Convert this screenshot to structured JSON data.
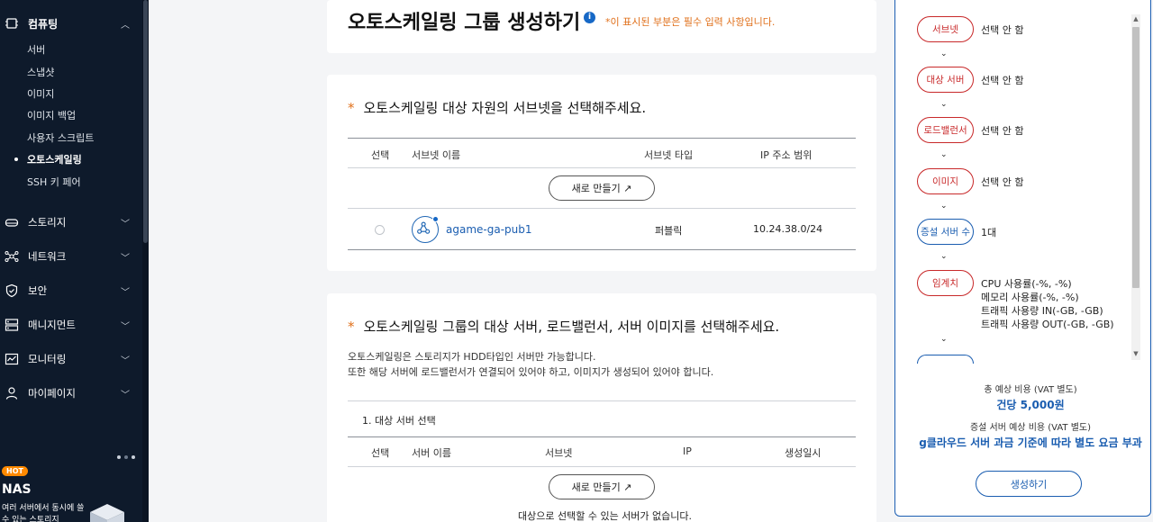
{
  "sidebar": {
    "computing": {
      "label": "컴퓨팅",
      "items": [
        "서버",
        "스냅샷",
        "이미지",
        "이미지 백업",
        "사용자 스크립트",
        "오토스케일링",
        "SSH 키 페어"
      ],
      "active_index": 5
    },
    "groups": [
      "스토리지",
      "네트워크",
      "보안",
      "매니지먼트",
      "모니터링",
      "마이페이지"
    ],
    "promo": {
      "badge": "HOT",
      "title": "NAS",
      "desc": "여러 서버에서 동시에 쓸 수 있는 스토리지"
    }
  },
  "header": {
    "title": "오토스케일링 그룹 생성하기",
    "info_icon": "i",
    "required_note": "*이 표시된 부분은 필수 입력 사항입니다."
  },
  "subnet_section": {
    "star": "*",
    "title": "오토스케일링 대상 자원의 서브넷을 선택해주세요.",
    "columns": [
      "선택",
      "서브넷 이름",
      "서브넷 타입",
      "IP 주소 범위"
    ],
    "new_button": "새로 만들기 ↗",
    "rows": [
      {
        "name": "agame-ga-pub1",
        "type": "퍼블릭",
        "ip_range": "10.24.38.0/24"
      }
    ]
  },
  "target_section": {
    "star": "*",
    "title": "오토스케일링 그룹의 대상 서버, 로드밸런서, 서버 이미지를 선택해주세요.",
    "desc_line1": "오토스케일링은 스토리지가 HDD타입인 서버만 가능합니다.",
    "desc_line2": "또한 해당 서버에 로드밸런서가 연결되어 있어야 하고, 이미지가 생성되어 있어야 합니다.",
    "subsection_label": "1. 대상 서버 선택",
    "columns": [
      "선택",
      "서버 이름",
      "서브넷",
      "IP",
      "생성일시"
    ],
    "new_button": "새로 만들기 ↗",
    "empty_message": "대상으로 선택할 수 있는 서버가 없습니다."
  },
  "summary": {
    "steps": [
      {
        "label": "서브넷",
        "value": "선택 안 함",
        "style": "red"
      },
      {
        "label": "대상 서버",
        "value": "선택 안 함",
        "style": "red"
      },
      {
        "label": "로드밸런서",
        "value": "선택 안 함",
        "style": "red"
      },
      {
        "label": "이미지",
        "value": "선택 안 함",
        "style": "red"
      },
      {
        "label": "증설 서버 수",
        "value": "1대",
        "style": "blue"
      },
      {
        "label": "임계치",
        "value_lines": [
          "CPU 사용률(-%, -%)",
          "메모리 사용률(-%, -%)",
          "트래픽 사용량 IN(-GB, -GB)",
          "트래픽 사용량 OUT(-GB, -GB)"
        ],
        "style": "red"
      }
    ],
    "total_cost_label": "총 예상 비용 (VAT 별도)",
    "total_cost_value": "건당 5,000원",
    "extra_cost_label": "증설 서버 예상 비용 (VAT 별도)",
    "extra_cost_value": "g클라우드 서버 과금 기준에 따라 별도 요금 부과",
    "create_button": "생성하기"
  },
  "colors": {
    "sidebar_bg": "#0e1a2b",
    "accent_blue": "#1a5db0",
    "required_orange": "#e0701b",
    "step_red": "#c8292a"
  }
}
